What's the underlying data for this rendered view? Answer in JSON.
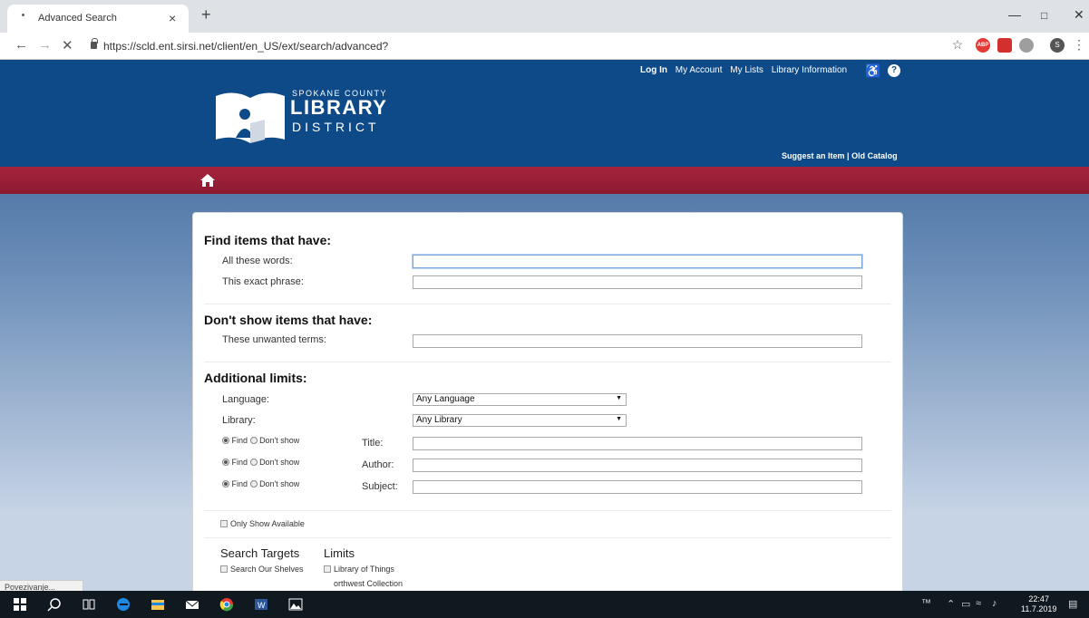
{
  "browser": {
    "tab_title": "Advanced Search",
    "close_glyph": "×",
    "new_tab_glyph": "+",
    "url": "https://scld.ent.sirsi.net/client/en_US/ext/search/advanced?",
    "profile_initial": "S",
    "abp_label": "ABP",
    "status_text": "Povezivanje..."
  },
  "header": {
    "links": [
      "Log In",
      "My Account",
      "My Lists",
      "Library Information"
    ],
    "logo": {
      "line1": "SPOKANE COUNTY",
      "line2": "LIBRARY",
      "line3": "DISTRICT"
    },
    "sub_links": {
      "suggest": "Suggest an Item",
      "separator": "|",
      "old_catalog": "Old Catalog"
    },
    "help_glyph": "?"
  },
  "form": {
    "find_title": "Find items that have:",
    "all_words_label": "All these words:",
    "exact_phrase_label": "This exact phrase:",
    "exclude_title": "Don't show items that have:",
    "unwanted_label": "These unwanted terms:",
    "limits_title": "Additional limits:",
    "language_label": "Language:",
    "language_value": "Any Language",
    "library_label": "Library:",
    "library_value": "Any Library",
    "find_option": "Find",
    "dont_show_option": "Don't show",
    "title_label": "Title:",
    "author_label": "Author:",
    "subject_label": "Subject:",
    "only_available_label": "Only Show Available",
    "search_targets_title": "Search Targets",
    "limits_heading": "Limits",
    "target_shelves": "Search Our Shelves",
    "limit_things": "Library of Things",
    "limit_northwest": "orthwest Collection"
  },
  "taskbar": {
    "time": "22:47",
    "date": "11.7.2019"
  }
}
